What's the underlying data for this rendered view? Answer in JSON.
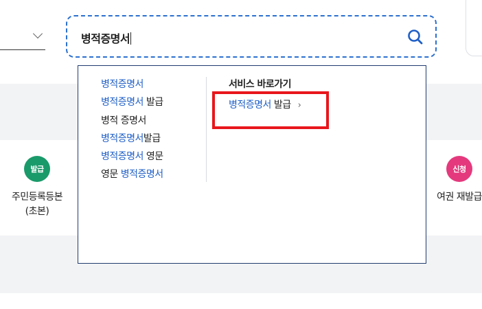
{
  "search": {
    "value": "병적증명서",
    "select_placeholder": ""
  },
  "autocomplete": {
    "suggestions": [
      {
        "hl_pre": "",
        "plain_pre": "",
        "hl": "병적증명서",
        "plain": ""
      },
      {
        "hl_pre": "",
        "plain_pre": "",
        "hl": "병적증명서",
        "plain": " 발급"
      },
      {
        "hl_pre": "",
        "plain_pre": "",
        "hl": "",
        "plain": "병적 증명서"
      },
      {
        "hl_pre": "",
        "plain_pre": "",
        "hl": "병적증명서",
        "plain": "발급"
      },
      {
        "hl_pre": "",
        "plain_pre": "",
        "hl": "병적증명서",
        "plain": " 영문"
      },
      {
        "hl_pre": "",
        "plain_pre": "영문 ",
        "hl": "병적증명서",
        "plain": ""
      }
    ],
    "quick": {
      "title": "서비스 바로가기",
      "link_hl": "병적증명서",
      "link_plain": " 발급",
      "arrow": "›"
    }
  },
  "services": {
    "left": {
      "badge": "발급",
      "label_line1": "주민등록등본",
      "label_line2": "(초본)"
    },
    "right": {
      "badge": "신청",
      "label_line1": "여권 재발급"
    }
  },
  "colors": {
    "accent_blue": "#1f5fc7",
    "badge_issue": "#1a9a6a",
    "badge_apply": "#e4397d",
    "highlight_red": "#e8161b"
  }
}
